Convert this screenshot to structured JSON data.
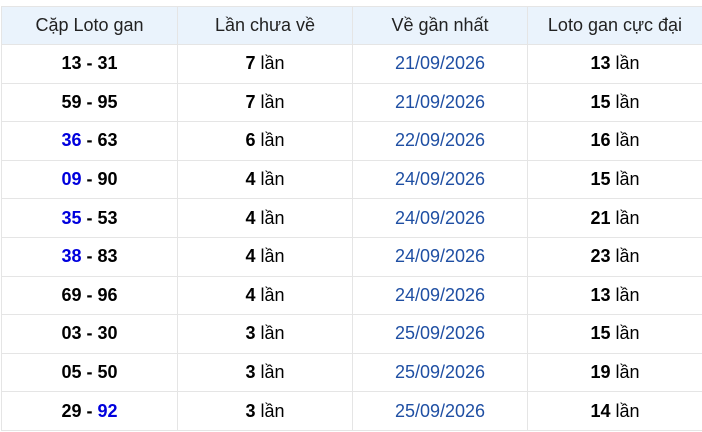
{
  "table": {
    "headers": [
      "Cặp Loto gan",
      "Lần chưa về",
      "Về gần nhất",
      "Loto gan cực đại"
    ],
    "unit": "lần",
    "separator": " - ",
    "rows": [
      {
        "a": "13",
        "a_hl": false,
        "b": "31",
        "b_hl": false,
        "count": "7",
        "last": "21/09/2026",
        "max": "13"
      },
      {
        "a": "59",
        "a_hl": false,
        "b": "95",
        "b_hl": false,
        "count": "7",
        "last": "21/09/2026",
        "max": "15"
      },
      {
        "a": "36",
        "a_hl": true,
        "b": "63",
        "b_hl": false,
        "count": "6",
        "last": "22/09/2026",
        "max": "16"
      },
      {
        "a": "09",
        "a_hl": true,
        "b": "90",
        "b_hl": false,
        "count": "4",
        "last": "24/09/2026",
        "max": "15"
      },
      {
        "a": "35",
        "a_hl": true,
        "b": "53",
        "b_hl": false,
        "count": "4",
        "last": "24/09/2026",
        "max": "21"
      },
      {
        "a": "38",
        "a_hl": true,
        "b": "83",
        "b_hl": false,
        "count": "4",
        "last": "24/09/2026",
        "max": "23"
      },
      {
        "a": "69",
        "a_hl": false,
        "b": "96",
        "b_hl": false,
        "count": "4",
        "last": "24/09/2026",
        "max": "13"
      },
      {
        "a": "03",
        "a_hl": false,
        "b": "30",
        "b_hl": false,
        "count": "3",
        "last": "25/09/2026",
        "max": "15"
      },
      {
        "a": "05",
        "a_hl": false,
        "b": "50",
        "b_hl": false,
        "count": "3",
        "last": "25/09/2026",
        "max": "19"
      },
      {
        "a": "29",
        "a_hl": false,
        "b": "92",
        "b_hl": true,
        "count": "3",
        "last": "25/09/2026",
        "max": "14"
      }
    ]
  },
  "colors": {
    "header_bg": "#eaf3fc",
    "highlight": "#0000dd",
    "date": "#1f4fa3",
    "border": "#e5e5e5"
  }
}
